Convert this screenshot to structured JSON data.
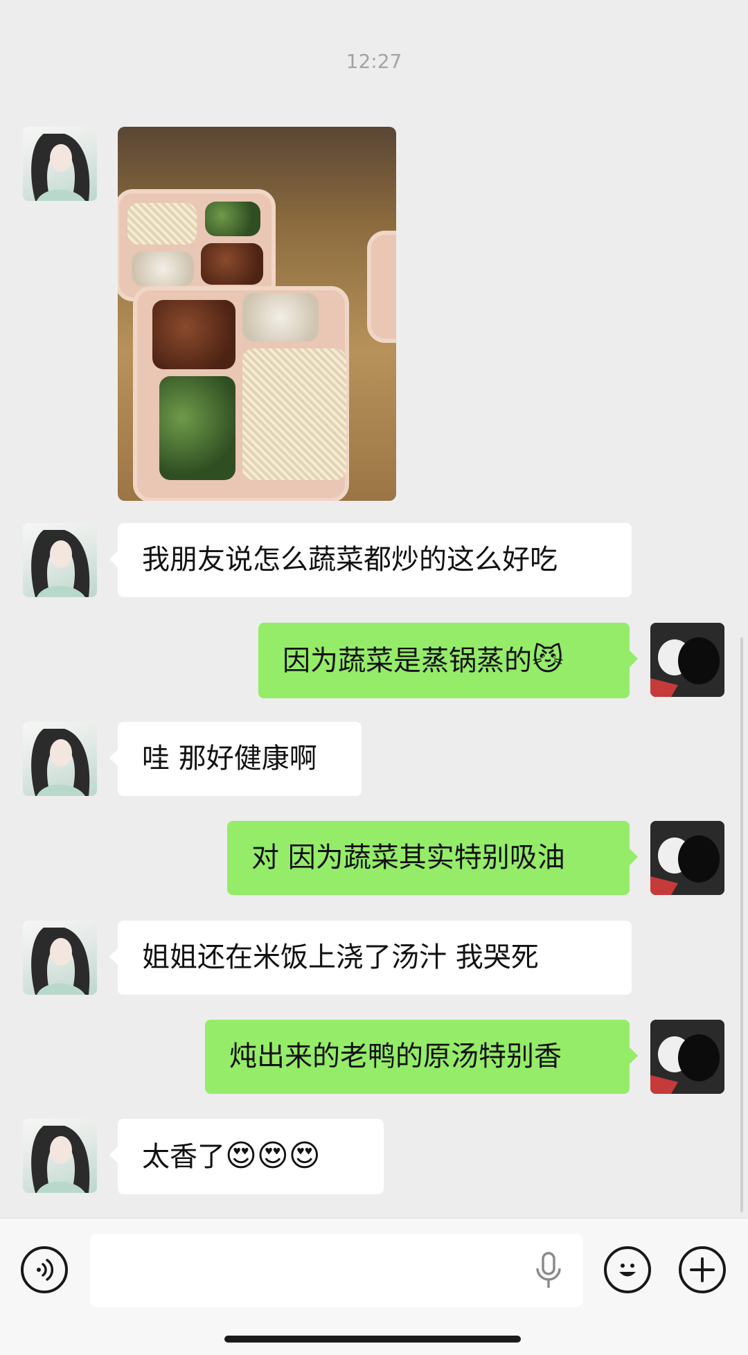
{
  "timestamp": "12:27",
  "messages": [
    {
      "side": "left",
      "type": "image",
      "alt": ""
    },
    {
      "side": "left",
      "type": "text",
      "text": "我朋友说怎么蔬菜都炒的这么好吃"
    },
    {
      "side": "right",
      "type": "text",
      "text": "因为蔬菜是蒸锅蒸的",
      "emoji": "😼"
    },
    {
      "side": "left",
      "type": "text",
      "text": "哇 那好健康啊"
    },
    {
      "side": "right",
      "type": "text",
      "text": "对 因为蔬菜其实特别吸油"
    },
    {
      "side": "left",
      "type": "text",
      "text": "姐姐还在米饭上浇了汤汁 我哭死"
    },
    {
      "side": "right",
      "type": "text",
      "text": "炖出来的老鸭的原汤特别香"
    },
    {
      "side": "left",
      "type": "text",
      "text": "太香了",
      "emoji": "😍😍😍"
    }
  ],
  "input": {
    "placeholder": "",
    "value": ""
  },
  "icons": {
    "voice": "voice-icon",
    "mic": "microphone-icon",
    "emoji": "emoji-icon",
    "plus": "plus-icon"
  },
  "colors": {
    "background": "#ededed",
    "sent_bubble": "#95ec69",
    "received_bubble": "#ffffff",
    "timestamp": "#a3a3a3"
  }
}
